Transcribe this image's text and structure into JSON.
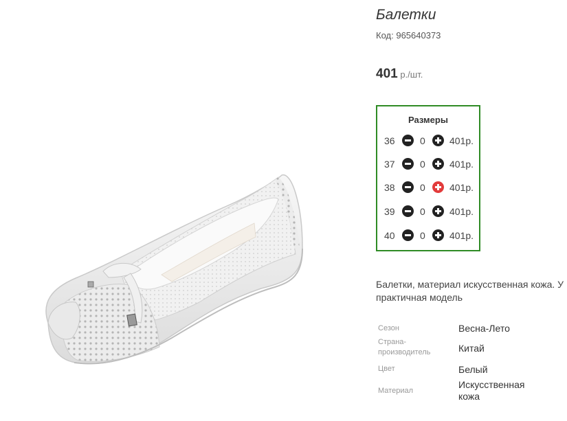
{
  "product": {
    "title": "Балетки",
    "code_label": "Код:",
    "code": "965640373",
    "price": "401",
    "price_unit": "р./шт."
  },
  "sizes": {
    "title": "Размеры",
    "rows": [
      {
        "size": "36",
        "qty": "0",
        "price": "401р.",
        "plus_active": false
      },
      {
        "size": "37",
        "qty": "0",
        "price": "401р.",
        "plus_active": false
      },
      {
        "size": "38",
        "qty": "0",
        "price": "401р.",
        "plus_active": true
      },
      {
        "size": "39",
        "qty": "0",
        "price": "401р.",
        "plus_active": false
      },
      {
        "size": "40",
        "qty": "0",
        "price": "401р.",
        "plus_active": false
      }
    ]
  },
  "description": {
    "line1": "Балетки, материал искусственная кожа. У",
    "line2": "практичная модель"
  },
  "attributes": [
    {
      "label_line1": "Сезон",
      "label_line2": "",
      "value_line1": "Весна-Лето",
      "value_line2": ""
    },
    {
      "label_line1": "Страна-",
      "label_line2": "производитель",
      "value_line1": "Китай",
      "value_line2": ""
    },
    {
      "label_line1": "Цвет",
      "label_line2": "",
      "value_line1": "Белый",
      "value_line2": ""
    },
    {
      "label_line1": "Материал",
      "label_line2": "",
      "value_line1": "Искусственная",
      "value_line2": "кожа"
    }
  ],
  "colors": {
    "sizes_border": "#2e8b24",
    "active_plus": "#e23b3b",
    "button_dark": "#222222"
  }
}
